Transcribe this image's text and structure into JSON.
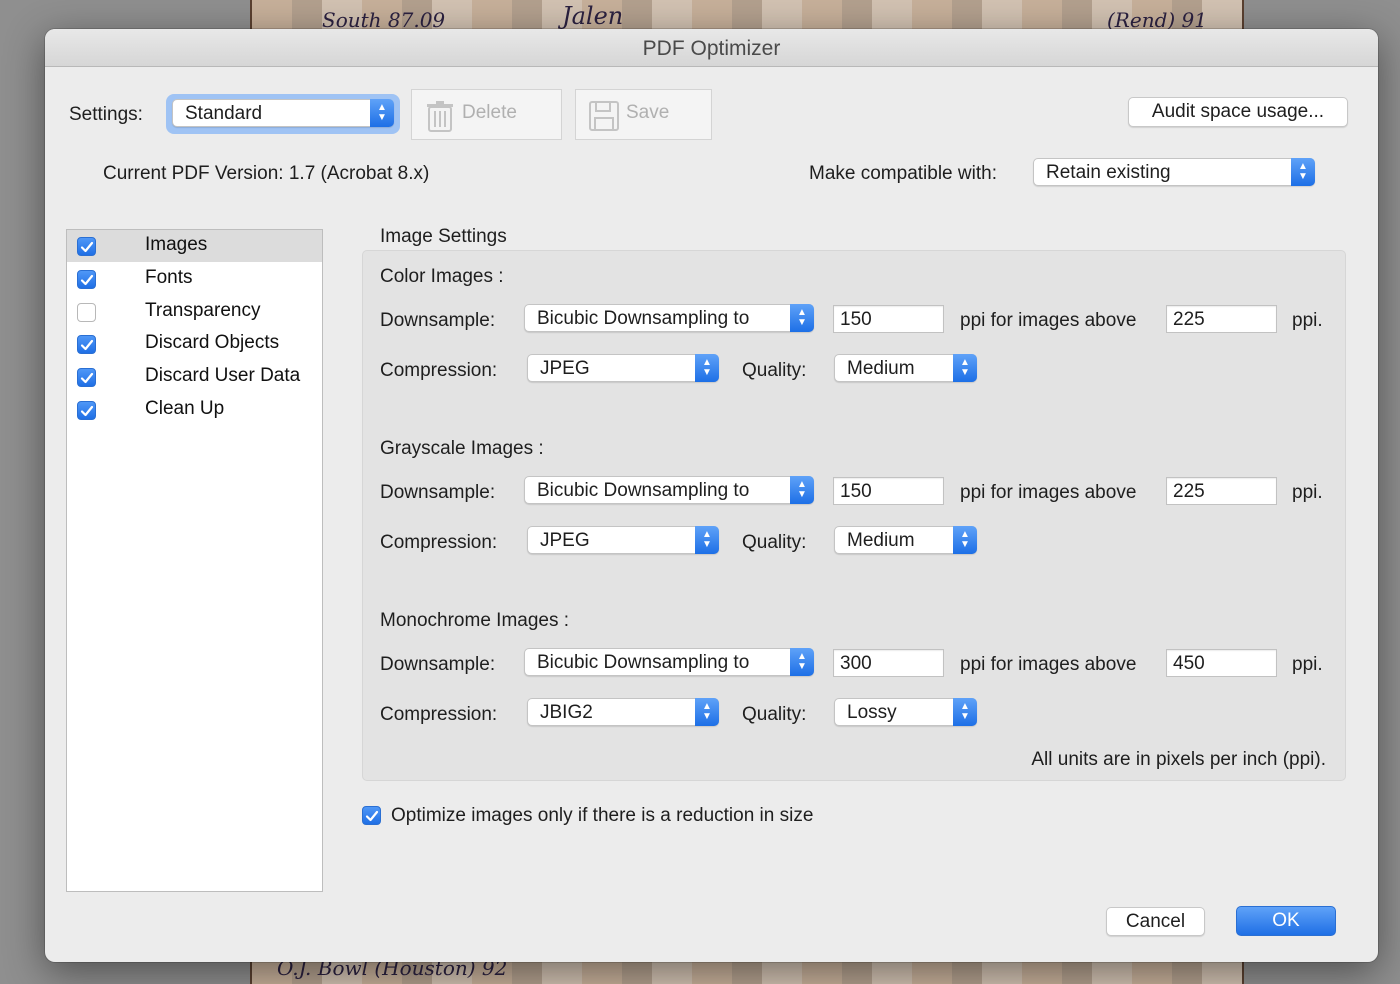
{
  "background": {
    "top_handwriting_left": "South 87.09",
    "top_handwriting_mid": "Jalen",
    "top_handwriting_right": "(Rend) 91",
    "bottom_handwriting_left": "O.J. Bowl (Houston) 92"
  },
  "dialog": {
    "title": "PDF Optimizer"
  },
  "toolbar": {
    "settings_label": "Settings:",
    "settings_value": "Standard",
    "delete_label": "Delete",
    "save_label": "Save",
    "audit_label": "Audit space usage..."
  },
  "version": {
    "current_text": "Current PDF Version: 1.7 (Acrobat 8.x)",
    "compat_label": "Make compatible with:",
    "compat_value": "Retain existing"
  },
  "sidebar": {
    "items": [
      {
        "label": "Images",
        "checked": true,
        "selected": true
      },
      {
        "label": "Fonts",
        "checked": true,
        "selected": false
      },
      {
        "label": "Transparency",
        "checked": false,
        "selected": false
      },
      {
        "label": "Discard Objects",
        "checked": true,
        "selected": false
      },
      {
        "label": "Discard User Data",
        "checked": true,
        "selected": false
      },
      {
        "label": "Clean Up",
        "checked": true,
        "selected": false
      }
    ]
  },
  "image_settings": {
    "title": "Image Settings",
    "sections": [
      {
        "heading": "Color Images :",
        "downsample_label": "Downsample:",
        "downsample_value": "Bicubic Downsampling to",
        "ppi_value": "150",
        "above_label": "ppi for images above",
        "above_value": "225",
        "ppi_suffix": "ppi.",
        "compression_label": "Compression:",
        "compression_value": "JPEG",
        "quality_label": "Quality:",
        "quality_value": "Medium"
      },
      {
        "heading": "Grayscale Images :",
        "downsample_label": "Downsample:",
        "downsample_value": "Bicubic Downsampling to",
        "ppi_value": "150",
        "above_label": "ppi for images above",
        "above_value": "225",
        "ppi_suffix": "ppi.",
        "compression_label": "Compression:",
        "compression_value": "JPEG",
        "quality_label": "Quality:",
        "quality_value": "Medium"
      },
      {
        "heading": "Monochrome Images :",
        "downsample_label": "Downsample:",
        "downsample_value": "Bicubic Downsampling to",
        "ppi_value": "300",
        "above_label": "ppi for images above",
        "above_value": "450",
        "ppi_suffix": "ppi.",
        "compression_label": "Compression:",
        "compression_value": "JBIG2",
        "quality_label": "Quality:",
        "quality_value": "Lossy"
      }
    ],
    "units_note": "All units are in pixels per inch (ppi)."
  },
  "optimize_option": {
    "label": "Optimize images only if there is a reduction in size",
    "checked": true
  },
  "footer": {
    "cancel_label": "Cancel",
    "ok_label": "OK"
  },
  "colors": {
    "accent": "#1f6fe5",
    "dialog_bg": "#ececec"
  }
}
